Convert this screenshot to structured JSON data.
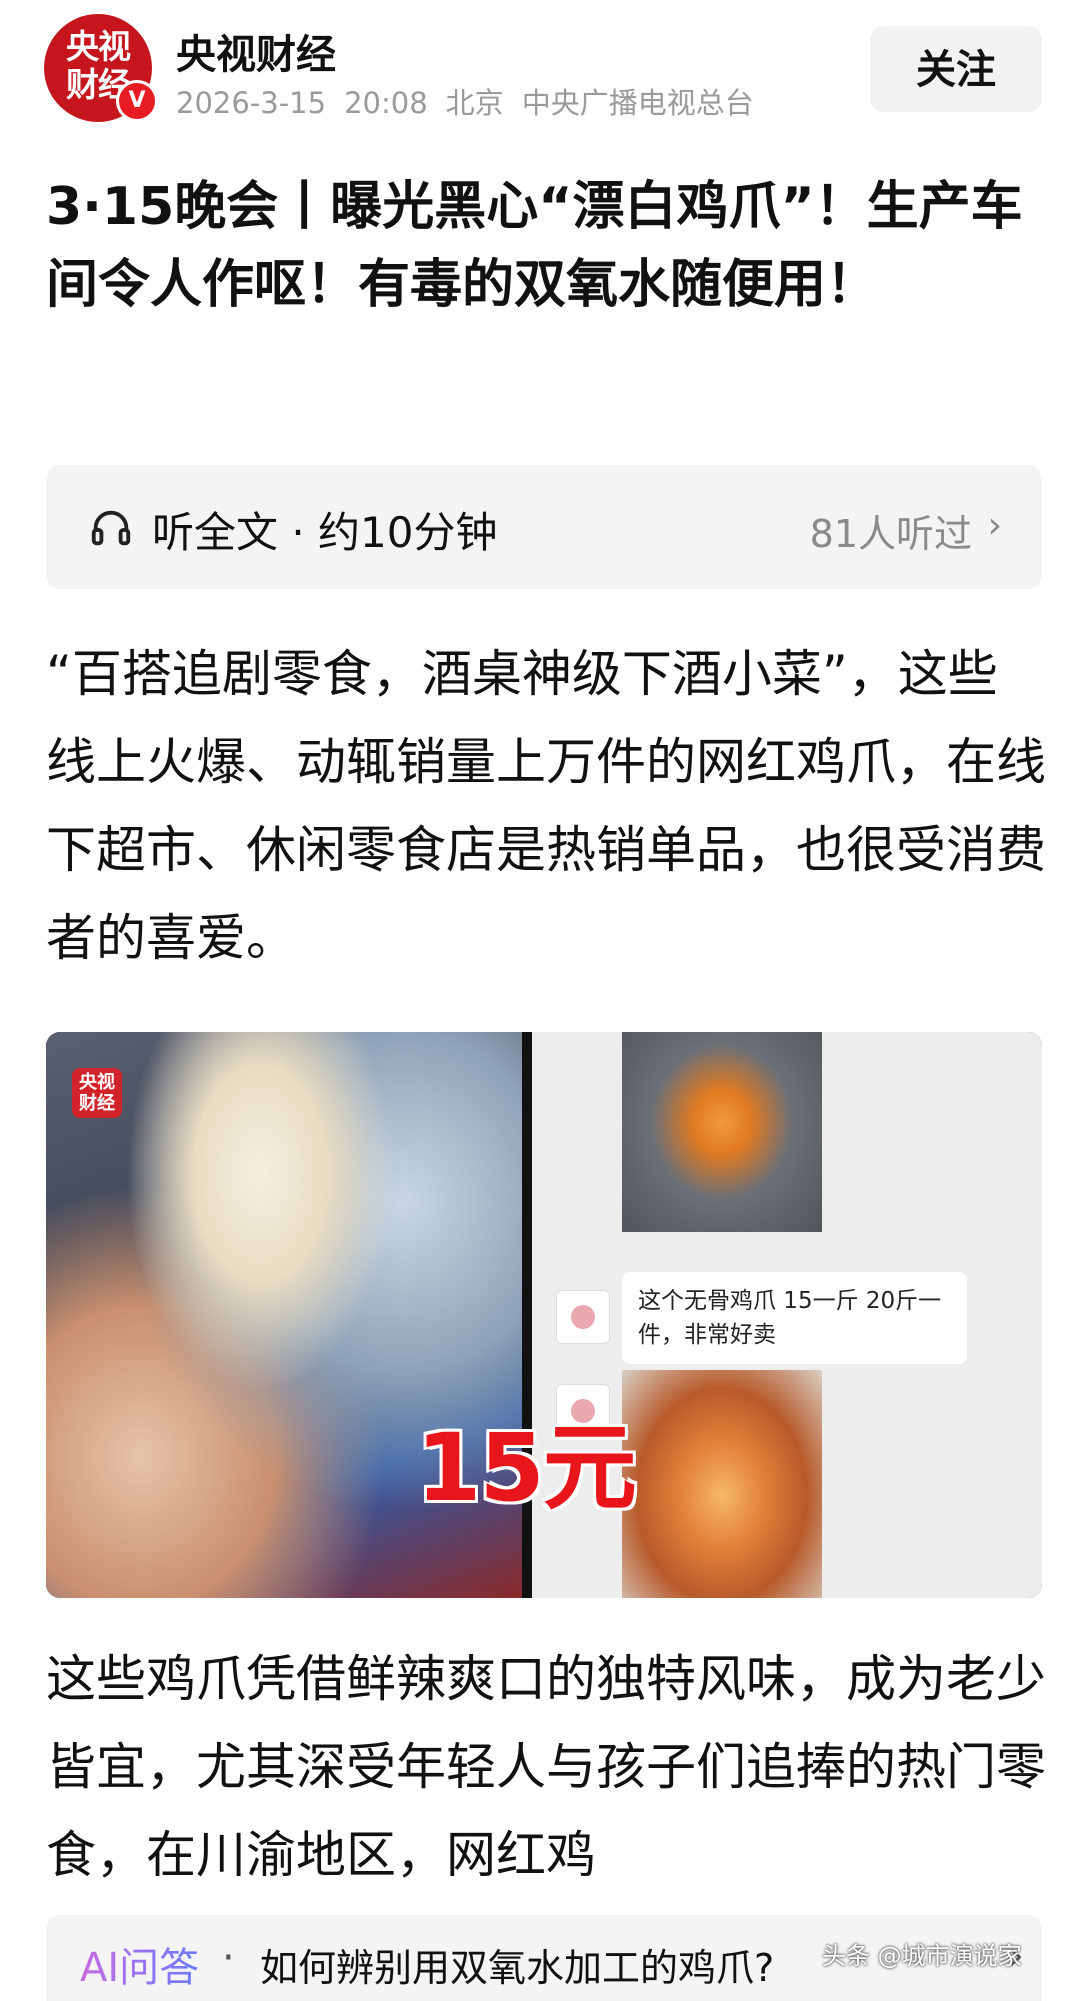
{
  "account": {
    "avatar_text": "央视\n财经",
    "name": "央视财经",
    "date": "2026-3-15",
    "time": "20:08",
    "location": "北京",
    "source": "中央广播电视总台",
    "follow_label": "关注",
    "verified_badge": "V"
  },
  "article": {
    "title": "3·15晚会丨曝光黑心“漂白鸡爪”！生产车间令人作呕！有毒的双氧水随便用！",
    "paragraph1": "“百搭追剧零食，酒桌神级下酒小菜”，这些线上火爆、动辄销量上万件的网红鸡爪，在线下超市、休闲零食店是热销单品，也很受消费者的喜爱。",
    "paragraph2": "这些鸡爪凭借鲜辣爽口的独特风味，成为老少皆宜，尤其深受年轻人与孩子们追捧的热门零食，在川渝地区，网红鸡"
  },
  "listen": {
    "label": "听全文 · 约10分钟",
    "count": "81人听过",
    "icon": "headphone-icon",
    "chevron": "›"
  },
  "figure": {
    "logo_text": "央视\n财经",
    "chat_text": "这个无骨鸡爪 15一斤 20斤一件，非常好卖",
    "price_overlay": "15元"
  },
  "ai_bar": {
    "label": "AI问答",
    "dot": "·",
    "question": "如何辨别用双氧水加工的鸡爪?",
    "chevron": "›"
  },
  "watermark": "头条 @城市演说家",
  "colors": {
    "brand_red": "#c4161c",
    "price_red": "#e8161b",
    "meta_gray": "#9a9a9a",
    "panel_bg": "#f4f4f4"
  }
}
